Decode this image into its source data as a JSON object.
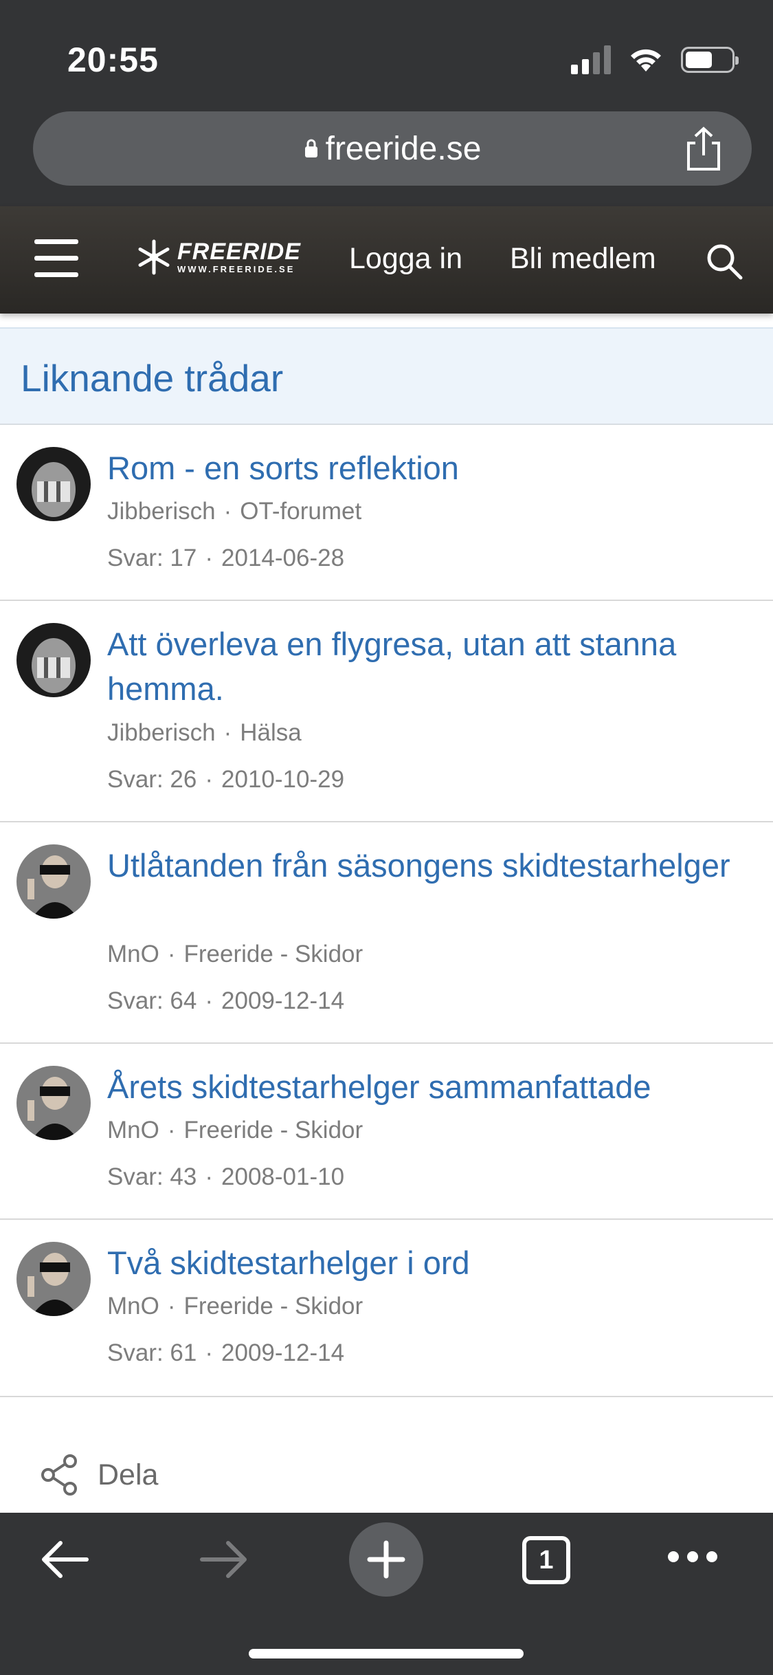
{
  "status_bar": {
    "time": "20:55"
  },
  "browser": {
    "url": "freeride.se"
  },
  "site_header": {
    "logo_main": "FREERIDE",
    "logo_sub": "WWW.FREERIDE.SE",
    "login_label": "Logga in",
    "register_label": "Bli medlem"
  },
  "section": {
    "title": "Liknande trådar"
  },
  "threads": [
    {
      "title": "Rom - en sorts reflektion",
      "author": "Jibberisch",
      "forum": "OT-forumet",
      "replies": "Svar: 17",
      "date": "2014-06-28"
    },
    {
      "title": "Att överleva en flygresa, utan att stanna hemma.",
      "author": "Jibberisch",
      "forum": "Hälsa",
      "replies": "Svar: 26",
      "date": "2010-10-29"
    },
    {
      "title": "Utlåtanden från säsongens skidtestarhelger",
      "author": "MnO",
      "forum": "Freeride - Skidor",
      "replies": "Svar: 64",
      "date": "2009-12-14"
    },
    {
      "title": "Årets skidtestarhelger sammanfattade",
      "author": "MnO",
      "forum": "Freeride - Skidor",
      "replies": "Svar: 43",
      "date": "2008-01-10"
    },
    {
      "title": "Två skidtestarhelger i ord",
      "author": "MnO",
      "forum": "Freeride - Skidor",
      "replies": "Svar: 61",
      "date": "2009-12-14"
    }
  ],
  "share": {
    "label": "Dela"
  },
  "toolbar": {
    "tab_count": "1"
  },
  "colors": {
    "link": "#2f6db0",
    "meta": "#7d7d7d",
    "chrome": "#333436"
  }
}
